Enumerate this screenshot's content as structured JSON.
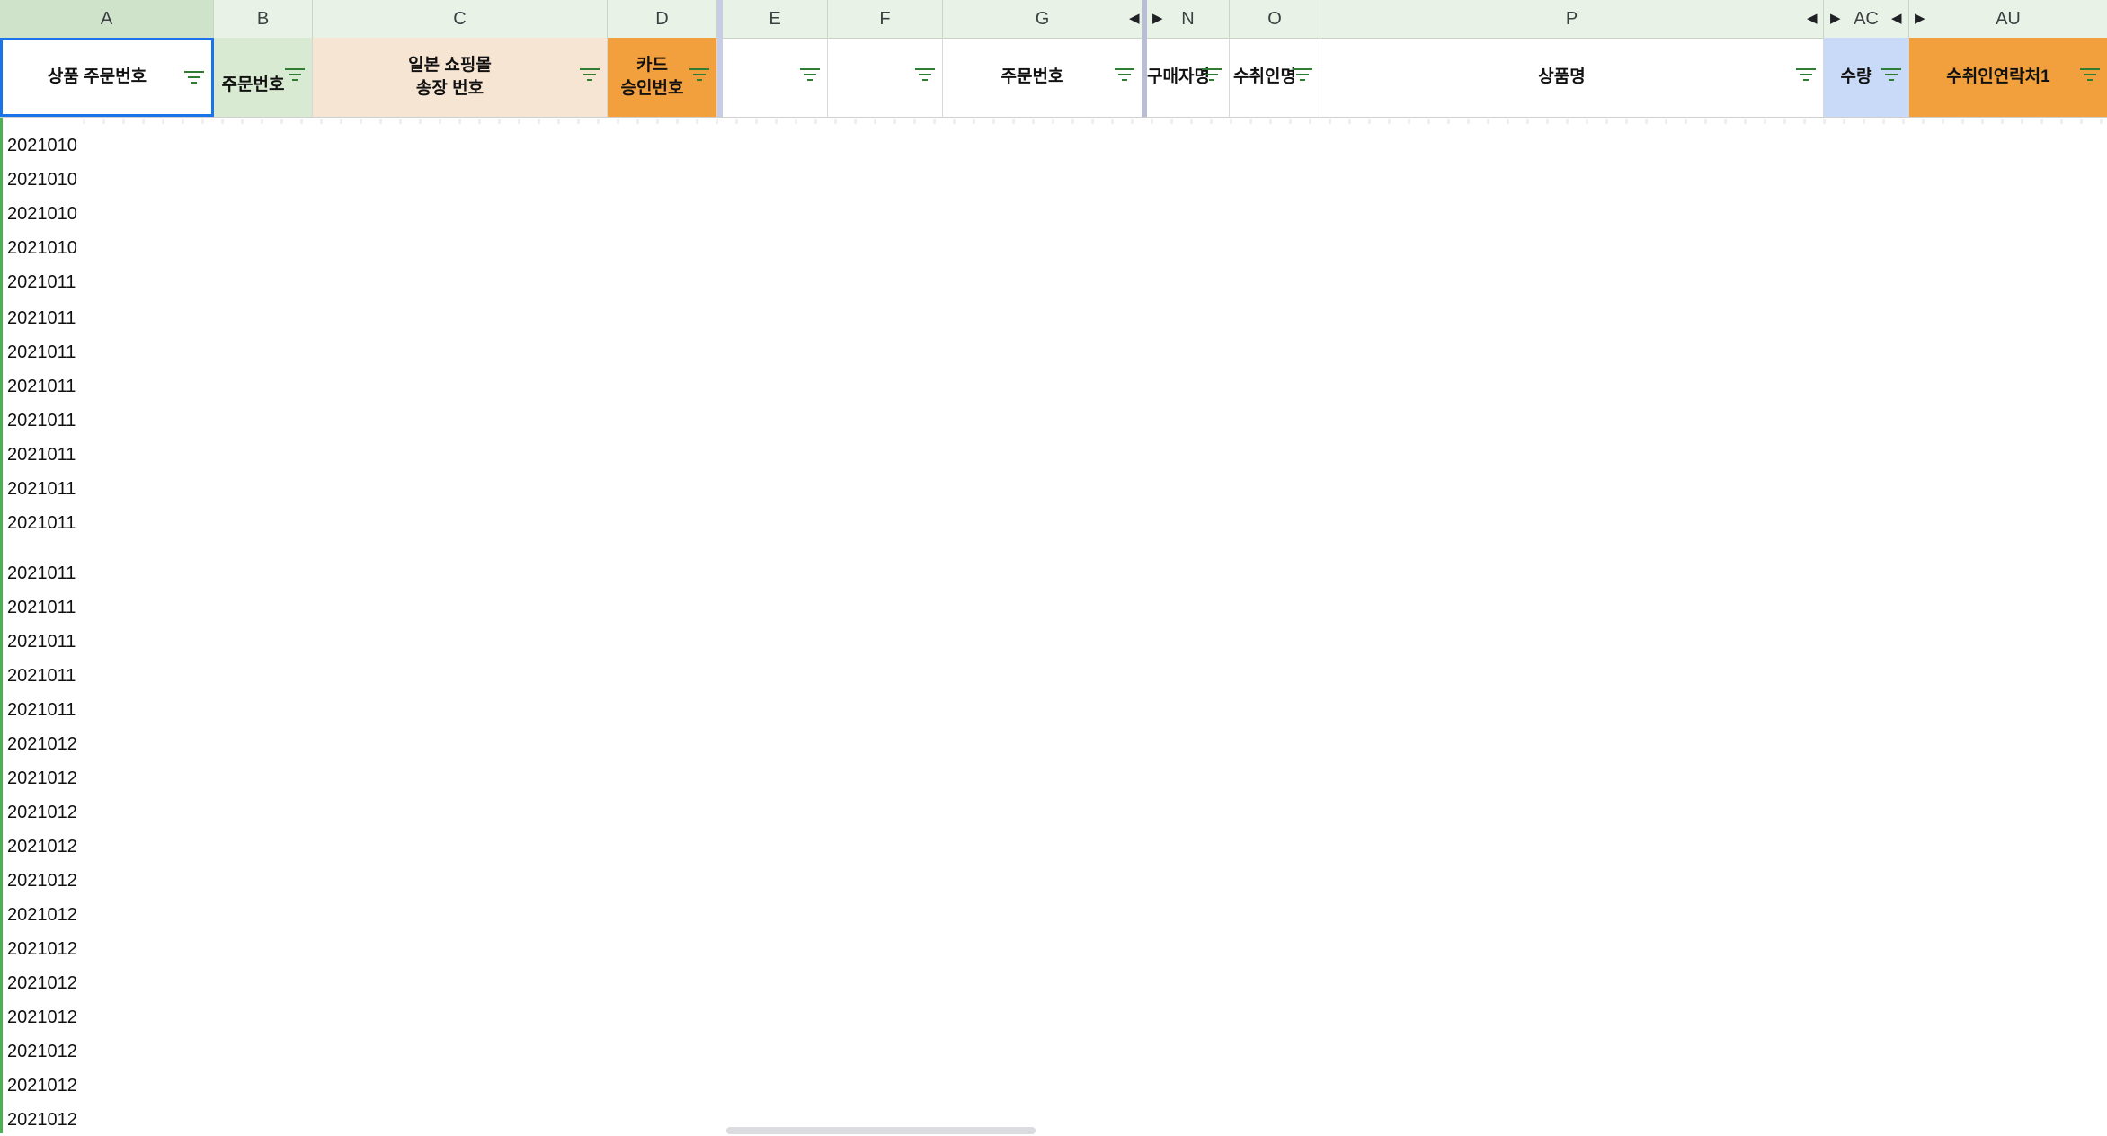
{
  "column_letters": {
    "A": "A",
    "B": "B",
    "C": "C",
    "D": "D",
    "E": "E",
    "F": "F",
    "G": "G",
    "N": "N",
    "O": "O",
    "P": "P",
    "AC": "AC",
    "AU": "AU"
  },
  "headers": {
    "A": "상품 주문번호",
    "B": "주문번호",
    "C": "일본 쇼핑몰\n송장 번호",
    "D": "카드\n승인번호",
    "E": "",
    "F": "",
    "G": "주문번호",
    "N": "구매자명",
    "O": "수취인명",
    "P": "상품명",
    "AC": "수량",
    "AU": "수취인연락처1"
  },
  "colors": {
    "header_c": "#f7e5d4",
    "header_d": "#f2a03d",
    "header_b": "#d9ead3",
    "header_ac": "#c9daf8",
    "header_au": "#f2a03d",
    "accent": "#1a73e8",
    "filter_icon": "#2e7d32"
  },
  "rows": [
    "2021010",
    "2021010",
    "2021010",
    "2021010",
    "2021011",
    "2021011",
    "2021011",
    "2021011",
    "2021011",
    "2021011",
    "2021011",
    "2021011",
    "2021011",
    "2021011",
    "2021011",
    "2021011",
    "2021011",
    "2021012",
    "2021012",
    "2021012",
    "2021012",
    "2021012",
    "2021012",
    "2021012",
    "2021012",
    "2021012",
    "2021012",
    "2021012",
    "2021012"
  ]
}
